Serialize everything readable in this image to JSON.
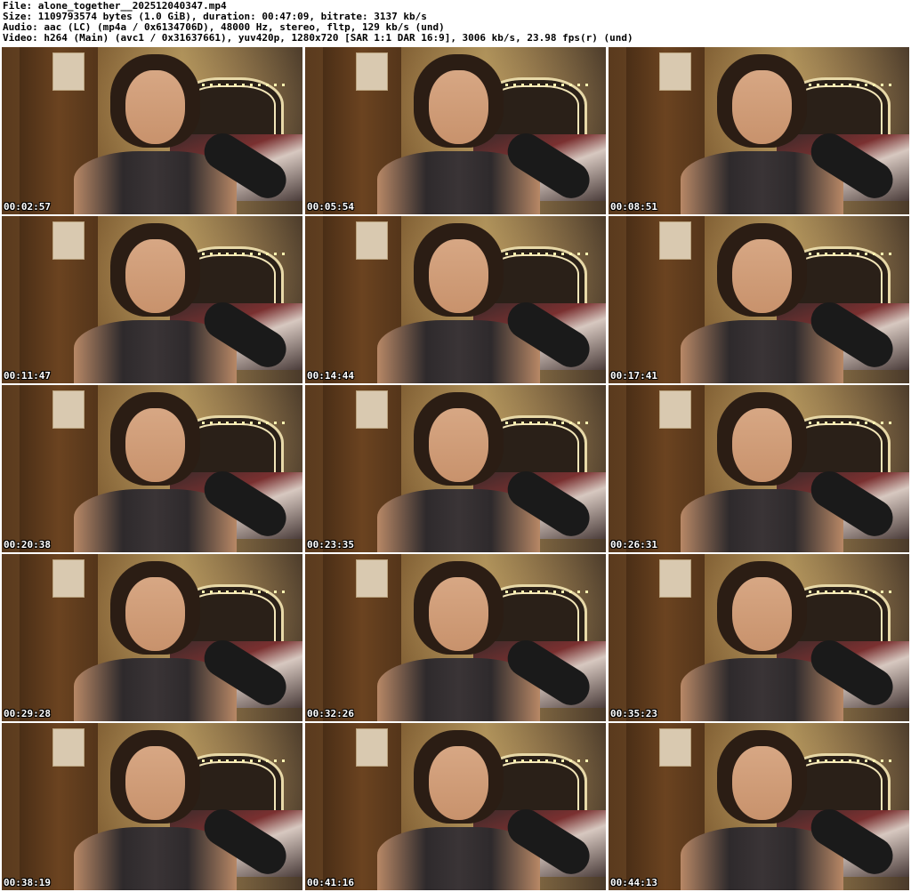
{
  "header": {
    "file_line": "File: alone_together__202512040347.mp4",
    "size_line": "Size: 1109793574 bytes (1.0 GiB), duration: 00:47:09, bitrate: 3137 kb/s",
    "audio_line": "Audio: aac (LC) (mp4a / 0x6134706D), 48000 Hz, stereo, fltp, 129 kb/s (und)",
    "video_line": "Video: h264 (Main) (avc1 / 0x31637661), yuv420p, 1280x720 [SAR 1:1 DAR 16:9], 3006 kb/s, 23.98 fps(r) (und)"
  },
  "thumbnails": [
    {
      "timestamp": "00:02:57"
    },
    {
      "timestamp": "00:05:54"
    },
    {
      "timestamp": "00:08:51"
    },
    {
      "timestamp": "00:11:47"
    },
    {
      "timestamp": "00:14:44"
    },
    {
      "timestamp": "00:17:41"
    },
    {
      "timestamp": "00:20:38"
    },
    {
      "timestamp": "00:23:35"
    },
    {
      "timestamp": "00:26:31"
    },
    {
      "timestamp": "00:29:28"
    },
    {
      "timestamp": "00:32:26"
    },
    {
      "timestamp": "00:35:23"
    },
    {
      "timestamp": "00:38:19"
    },
    {
      "timestamp": "00:41:16"
    },
    {
      "timestamp": "00:44:13"
    }
  ]
}
